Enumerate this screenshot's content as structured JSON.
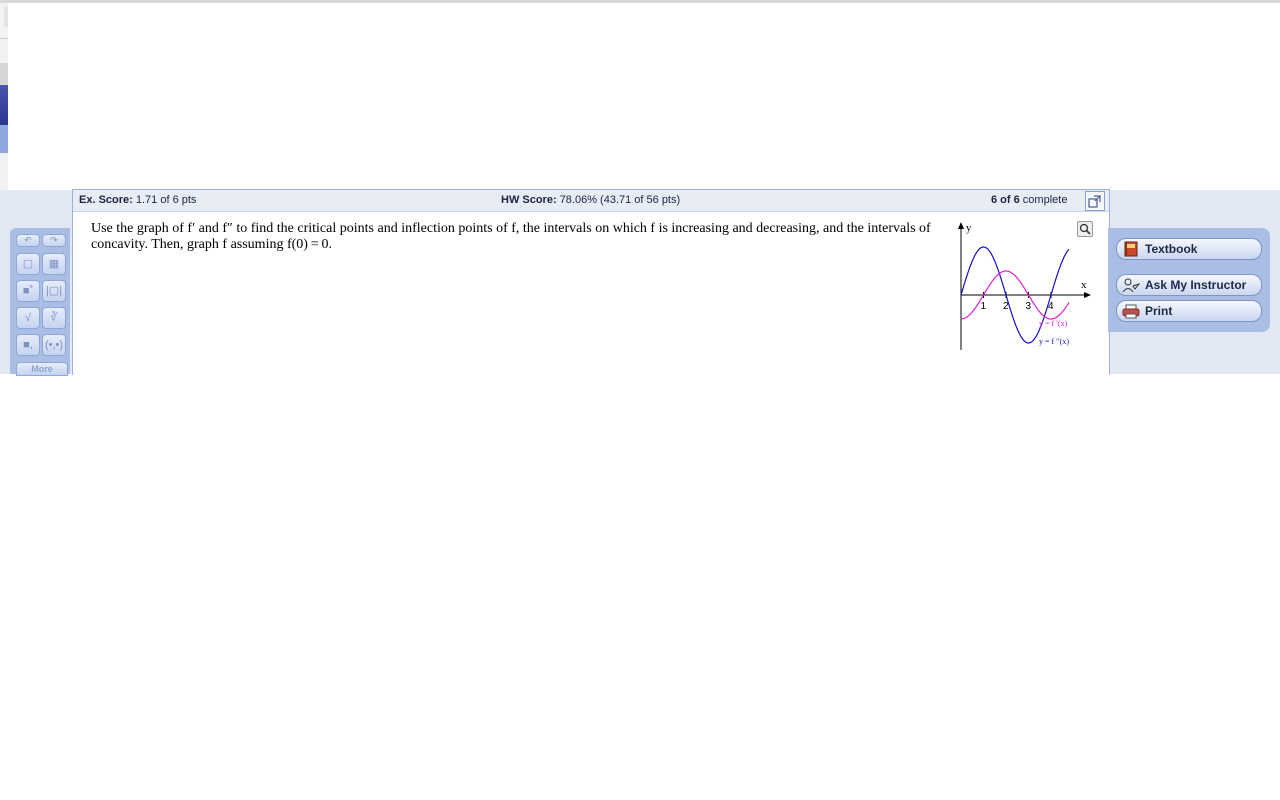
{
  "score_bar": {
    "ex_score_label": "Ex. Score:",
    "ex_score_value": "1.71 of 6 pts",
    "hw_score_label": "HW Score:",
    "hw_score_value": "78.06% (43.71 of 56 pts)",
    "progress_bold": "6 of 6",
    "progress_text": "complete"
  },
  "question": {
    "text": "Use the graph of f′ and f″ to find the critical points and inflection points of f, the intervals on which f is increasing and decreasing, and the intervals of concavity. Then, graph f assuming f(0) = 0."
  },
  "graph": {
    "y_axis_label": "y",
    "x_axis_label": "x",
    "ticks": [
      "1",
      "2",
      "3",
      "4"
    ],
    "f_prime_label": "y = f ′(x)",
    "f_double_prime_label": "y = f ′′(x)",
    "colors": {
      "f_prime": "#e020d0",
      "f_double_prime": "#1010d0"
    }
  },
  "math_palette": {
    "more_label": "More",
    "icons": [
      "undo-icon",
      "redo-icon",
      "fraction-icon",
      "mixed-fraction-icon",
      "exponent-icon",
      "absolute-value-icon",
      "square-root-icon",
      "nth-root-icon",
      "subscript-icon",
      "interval-icon"
    ]
  },
  "side_panel": {
    "textbook_label": "Textbook",
    "ask_instructor_label": "Ask My Instructor",
    "print_label": "Print"
  }
}
